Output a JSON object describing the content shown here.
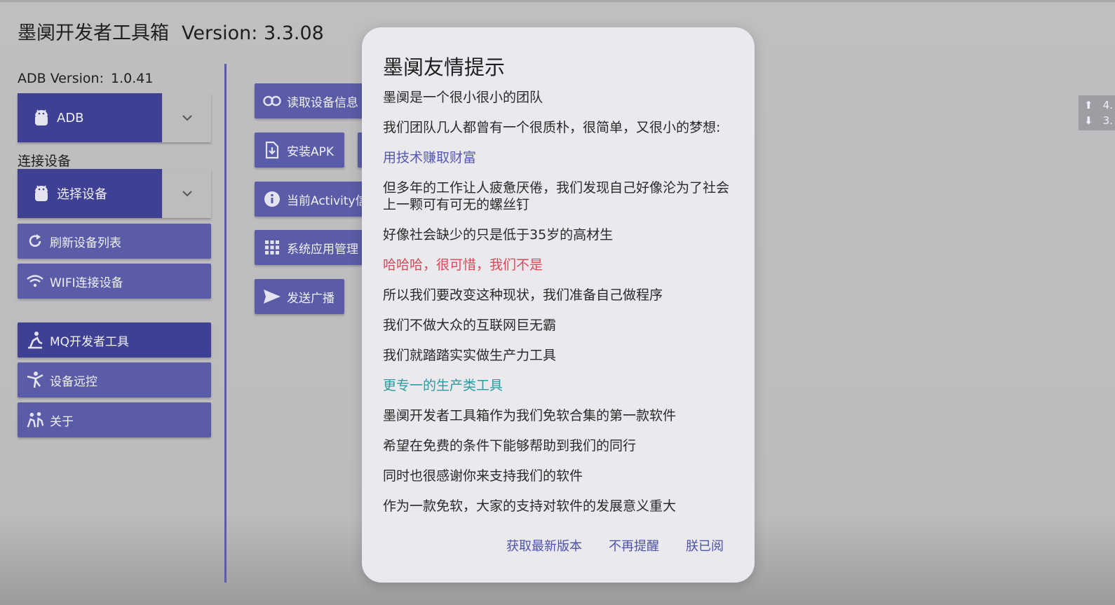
{
  "app": {
    "title": "墨阒开发者工具箱",
    "version": "Version: 3.3.08"
  },
  "sidebar": {
    "adb_label": "ADB Version:",
    "adb_version": "1.0.41",
    "adb_select": "ADB",
    "connect_label": "连接设备",
    "device_select": "选择设备",
    "refresh": "刷新设备列表",
    "wifi": "WIFI连接设备",
    "mq_tools": "MQ开发者工具",
    "remote": "设备远控",
    "about": "关于"
  },
  "tools": {
    "read_info": "读取设备信息",
    "install_apk": "安装APK",
    "current_activity": "当前Activity信",
    "system_apps": "系统应用管理",
    "broadcast": "发送广播"
  },
  "mini_panel": {
    "up_value": "4.",
    "down_value": "3."
  },
  "dialog": {
    "title": "墨阒友情提示",
    "lines": [
      "墨阒是一个很小很小的团队",
      "我们团队几人都曾有一个很质朴，很简单，又很小的梦想:",
      "用技术赚取财富",
      "但多年的工作让人疲惫厌倦，我们发现自己好像沦为了社会上一颗可有可无的螺丝钉",
      "好像社会缺少的只是低于35岁的高材生",
      "哈哈哈，很可惜，我们不是",
      "所以我们要改变这种现状，我们准备自己做程序",
      "我们不做大众的互联网巨无霸",
      "我们就踏踏实实做生产力工具",
      "更专一的生产类工具",
      "墨阒开发者工具箱作为我们免软合集的第一款软件",
      "希望在免费的条件下能够帮助到我们的同行",
      "同时也很感谢你来支持我们的软件",
      "作为一款免软，大家的支持对软件的发展意义重大"
    ],
    "actions": {
      "latest": "获取最新版本",
      "no_remind": "不再提醒",
      "read": "朕已阅"
    }
  },
  "colors": {
    "primary_dark": "#3e4094",
    "primary": "#5a5ca8",
    "link_blue": "#5558b0",
    "red": "#d84a5a",
    "teal": "#2e9aa0"
  }
}
